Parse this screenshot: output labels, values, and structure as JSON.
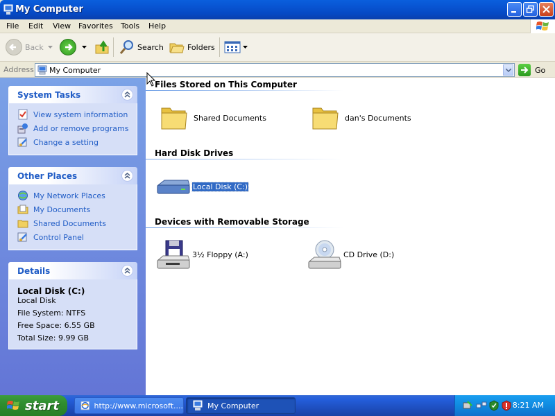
{
  "window": {
    "title": "My Computer"
  },
  "menu": [
    "File",
    "Edit",
    "View",
    "Favorites",
    "Tools",
    "Help"
  ],
  "toolbar": {
    "back_label": "Back",
    "search_label": "Search",
    "folders_label": "Folders"
  },
  "address": {
    "label": "Address",
    "value": "My Computer",
    "go_label": "Go"
  },
  "left_pane": {
    "system_tasks": {
      "title": "System Tasks",
      "items": [
        "View system information",
        "Add or remove programs",
        "Change a setting"
      ]
    },
    "other_places": {
      "title": "Other Places",
      "items": [
        "My Network Places",
        "My Documents",
        "Shared Documents",
        "Control Panel"
      ]
    },
    "details": {
      "title": "Details",
      "name": "Local Disk (C:)",
      "type": "Local Disk",
      "file_system": "File System: NTFS",
      "free_space": "Free Space: 6.55 GB",
      "total_size": "Total Size: 9.99 GB"
    }
  },
  "main": {
    "groups": [
      {
        "title": "Files Stored on This Computer",
        "items": [
          "Shared Documents",
          "dan's Documents"
        ]
      },
      {
        "title": "Hard Disk Drives",
        "items": [
          "Local Disk (C:)"
        ]
      },
      {
        "title": "Devices with Removable Storage",
        "items": [
          "3½ Floppy (A:)",
          "CD Drive (D:)"
        ]
      }
    ],
    "selected_item": "Local Disk (C:)"
  },
  "taskbar": {
    "start_label": "start",
    "buttons": [
      "http://www.microsoft....",
      "My Computer"
    ],
    "active_button": "My Computer",
    "clock": "8:21 AM"
  },
  "colors": {
    "titlebar": "#0854d2",
    "task_link": "#215dc6",
    "selection": "#316ac5",
    "start_green": "#2f8d2f"
  }
}
